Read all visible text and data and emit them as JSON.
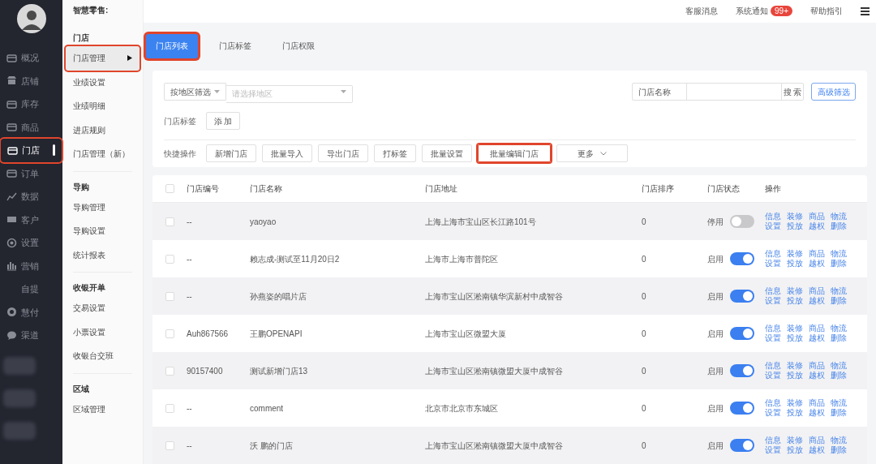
{
  "sidebar": {
    "items": [
      {
        "kind": "box",
        "label": "概况",
        "selected": false,
        "highlighted": false
      },
      {
        "kind": "shop",
        "label": "店铺",
        "selected": false,
        "highlighted": false
      },
      {
        "kind": "box",
        "label": "库存",
        "selected": false,
        "highlighted": false
      },
      {
        "kind": "box",
        "label": "商品",
        "selected": false,
        "highlighted": false
      },
      {
        "kind": "box",
        "label": "门店",
        "selected": true,
        "highlighted": true
      },
      {
        "kind": "box",
        "label": "订单",
        "selected": false,
        "highlighted": false
      },
      {
        "kind": "chart",
        "label": "数据",
        "selected": false,
        "highlighted": false
      },
      {
        "kind": "card",
        "label": "客户",
        "selected": false,
        "highlighted": false
      },
      {
        "kind": "gear",
        "label": "设置",
        "selected": false,
        "highlighted": false
      },
      {
        "kind": "bars",
        "label": "营销",
        "selected": false,
        "highlighted": false
      },
      {
        "kind": "plain",
        "label": "自提",
        "selected": false,
        "highlighted": false
      },
      {
        "kind": "coin",
        "label": "慧付",
        "selected": false,
        "highlighted": false
      },
      {
        "kind": "chat",
        "label": "渠道",
        "selected": false,
        "highlighted": false
      }
    ]
  },
  "subnav": {
    "title": "智慧零售:",
    "sections": [
      {
        "heading": "门店",
        "items": [
          {
            "label": "门店管理",
            "selected": true,
            "highlighted": true
          },
          {
            "label": "业绩设置",
            "selected": false,
            "highlighted": false
          },
          {
            "label": "业绩明细",
            "selected": false,
            "highlighted": false
          },
          {
            "label": "进店规则",
            "selected": false,
            "highlighted": false
          },
          {
            "label": "门店管理（新）",
            "selected": false,
            "highlighted": false
          }
        ]
      },
      {
        "heading": "导购",
        "items": [
          {
            "label": "导购管理",
            "selected": false,
            "highlighted": false
          },
          {
            "label": "导购设置",
            "selected": false,
            "highlighted": false
          },
          {
            "label": "统计报表",
            "selected": false,
            "highlighted": false
          }
        ]
      },
      {
        "heading": "收银开单",
        "items": [
          {
            "label": "交易设置",
            "selected": false,
            "highlighted": false
          },
          {
            "label": "小票设置",
            "selected": false,
            "highlighted": false
          },
          {
            "label": "收银台交班",
            "selected": false,
            "highlighted": false
          }
        ]
      },
      {
        "heading": "区域",
        "items": [
          {
            "label": "区域管理",
            "selected": false,
            "highlighted": false
          }
        ]
      }
    ]
  },
  "topbar": {
    "links": [
      {
        "label": "客服消息"
      },
      {
        "label": "系统通知",
        "badge": "99+"
      },
      {
        "label": "帮助指引"
      }
    ]
  },
  "tabs": [
    {
      "label": "门店列表",
      "selected": true,
      "highlighted": true
    },
    {
      "label": "门店标签",
      "selected": false,
      "highlighted": false
    },
    {
      "label": "门店权限",
      "selected": false,
      "highlighted": false
    }
  ],
  "filters": {
    "region_select": "按地区筛选",
    "region_field": {
      "placeholder": "请选择地区"
    },
    "search_select": "门店名称",
    "search_button": "搜 索",
    "advanced_button": "高级筛选"
  },
  "tag_row": {
    "label": "门店标签",
    "button": "添 加"
  },
  "quick_actions": {
    "label": "快捷操作",
    "buttons": [
      {
        "label": "新增门店",
        "highlighted": false
      },
      {
        "label": "批量导入",
        "highlighted": false
      },
      {
        "label": "导出门店",
        "highlighted": false
      },
      {
        "label": "打标签",
        "highlighted": false
      },
      {
        "label": "批量设置",
        "highlighted": false
      },
      {
        "label": "批量编辑门店",
        "highlighted": true
      }
    ],
    "more": "更多"
  },
  "table": {
    "all_checked": false,
    "columns": [
      "门店编号",
      "门店名称",
      "门店地址",
      "门店排序",
      "门店状态",
      "操作"
    ],
    "rows": [
      {
        "checked": false,
        "code": "--",
        "name": "yaoyao",
        "address": "上海上海市宝山区长江路101号",
        "sort": "0",
        "status_label": "停用",
        "enabled": false,
        "actions": [
          "信息",
          "装修",
          "商品",
          "物流",
          "设置",
          "投放",
          "越权",
          "删除"
        ]
      },
      {
        "checked": false,
        "code": "--",
        "name": "赖志成-测试至11月20日2",
        "address": "上海市上海市普陀区",
        "sort": "0",
        "status_label": "启用",
        "enabled": true,
        "actions": [
          "信息",
          "装修",
          "商品",
          "物流",
          "设置",
          "投放",
          "越权",
          "删除"
        ]
      },
      {
        "checked": false,
        "code": "--",
        "name": "孙燕姿的唱片店",
        "address": "上海市宝山区淞南镇华滨新村中成智谷",
        "sort": "0",
        "status_label": "启用",
        "enabled": true,
        "actions": [
          "信息",
          "装修",
          "商品",
          "物流",
          "设置",
          "投放",
          "越权",
          "删除"
        ]
      },
      {
        "checked": false,
        "code": "Auh867566",
        "name": "王鹏OPENAPI",
        "address": "上海市宝山区微盟大厦",
        "sort": "0",
        "status_label": "启用",
        "enabled": true,
        "actions": [
          "信息",
          "装修",
          "商品",
          "物流",
          "设置",
          "投放",
          "越权",
          "删除"
        ]
      },
      {
        "checked": false,
        "code": "90157400",
        "name": "测试新增门店13",
        "address": "上海市宝山区淞南镇微盟大厦中成智谷",
        "sort": "0",
        "status_label": "启用",
        "enabled": true,
        "actions": [
          "信息",
          "装修",
          "商品",
          "物流",
          "设置",
          "投放",
          "越权",
          "删除"
        ]
      },
      {
        "checked": false,
        "code": "--",
        "name": "comment",
        "address": "北京市北京市东城区",
        "sort": "0",
        "status_label": "启用",
        "enabled": true,
        "actions": [
          "信息",
          "装修",
          "商品",
          "物流",
          "设置",
          "投放",
          "越权",
          "删除"
        ]
      },
      {
        "checked": false,
        "code": "--",
        "name": "沃 鹏的门店",
        "address": "上海市宝山区淞南镇微盟大厦中成智谷",
        "sort": "0",
        "status_label": "启用",
        "enabled": true,
        "actions": [
          "信息",
          "装修",
          "商品",
          "物流",
          "设置",
          "投放",
          "越权",
          "删除"
        ]
      }
    ]
  }
}
